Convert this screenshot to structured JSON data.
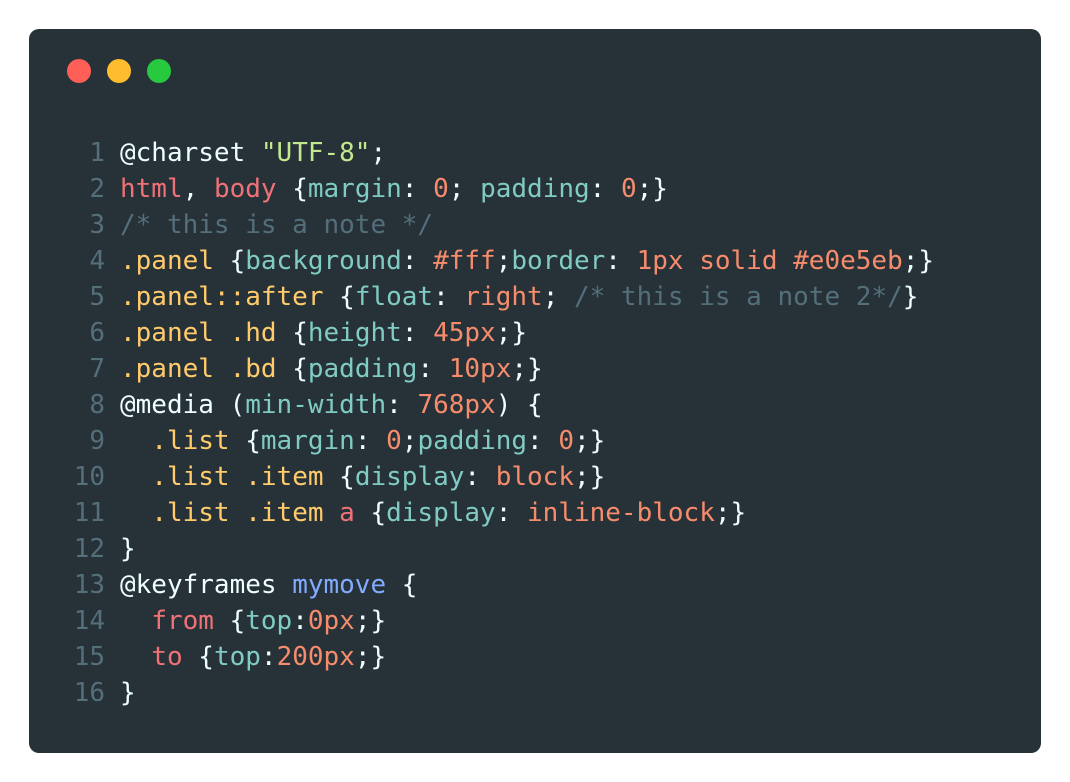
{
  "window": {
    "controls": [
      {
        "name": "close",
        "color": "#ff5f56"
      },
      {
        "name": "minimize",
        "color": "#ffbd2e"
      },
      {
        "name": "maximize",
        "color": "#27c93f"
      }
    ]
  },
  "colors": {
    "background": "#263238",
    "default": "#eeffff",
    "line_number": "#546e7a",
    "tag": "#f07178",
    "property": "#80cbc4",
    "number": "#f78c6c",
    "comment": "#546e7a",
    "selector": "#ffcb6b",
    "string": "#c3e88d",
    "function": "#82aaff",
    "atrule": "#eeffff"
  },
  "code_lines": [
    {
      "n": "1",
      "tokens": [
        {
          "t": "@charset ",
          "k": "atrule"
        },
        {
          "t": "\"UTF-8\"",
          "k": "string"
        },
        {
          "t": ";",
          "k": "default"
        }
      ]
    },
    {
      "n": "2",
      "tokens": [
        {
          "t": "html",
          "k": "tag"
        },
        {
          "t": ", ",
          "k": "default"
        },
        {
          "t": "body",
          "k": "tag"
        },
        {
          "t": " {",
          "k": "default"
        },
        {
          "t": "margin",
          "k": "property"
        },
        {
          "t": ": ",
          "k": "default"
        },
        {
          "t": "0",
          "k": "number"
        },
        {
          "t": "; ",
          "k": "default"
        },
        {
          "t": "padding",
          "k": "property"
        },
        {
          "t": ": ",
          "k": "default"
        },
        {
          "t": "0",
          "k": "number"
        },
        {
          "t": ";}",
          "k": "default"
        }
      ]
    },
    {
      "n": "3",
      "tokens": [
        {
          "t": "/* this is a note */",
          "k": "comment"
        }
      ]
    },
    {
      "n": "4",
      "tokens": [
        {
          "t": ".panel",
          "k": "selector"
        },
        {
          "t": " {",
          "k": "default"
        },
        {
          "t": "background",
          "k": "property"
        },
        {
          "t": ": ",
          "k": "default"
        },
        {
          "t": "#fff",
          "k": "number"
        },
        {
          "t": ";",
          "k": "default"
        },
        {
          "t": "border",
          "k": "property"
        },
        {
          "t": ": ",
          "k": "default"
        },
        {
          "t": "1px solid #e0e5eb",
          "k": "number"
        },
        {
          "t": ";}",
          "k": "default"
        }
      ]
    },
    {
      "n": "5",
      "tokens": [
        {
          "t": ".panel::after",
          "k": "selector"
        },
        {
          "t": " {",
          "k": "default"
        },
        {
          "t": "float",
          "k": "property"
        },
        {
          "t": ": ",
          "k": "default"
        },
        {
          "t": "right",
          "k": "number"
        },
        {
          "t": "; ",
          "k": "default"
        },
        {
          "t": "/* this is a note 2*/",
          "k": "comment"
        },
        {
          "t": "}",
          "k": "default"
        }
      ]
    },
    {
      "n": "6",
      "tokens": [
        {
          "t": ".panel .hd",
          "k": "selector"
        },
        {
          "t": " {",
          "k": "default"
        },
        {
          "t": "height",
          "k": "property"
        },
        {
          "t": ": ",
          "k": "default"
        },
        {
          "t": "45px",
          "k": "number"
        },
        {
          "t": ";}",
          "k": "default"
        }
      ]
    },
    {
      "n": "7",
      "tokens": [
        {
          "t": ".panel .bd",
          "k": "selector"
        },
        {
          "t": " {",
          "k": "default"
        },
        {
          "t": "padding",
          "k": "property"
        },
        {
          "t": ": ",
          "k": "default"
        },
        {
          "t": "10px",
          "k": "number"
        },
        {
          "t": ";}",
          "k": "default"
        }
      ]
    },
    {
      "n": "8",
      "tokens": [
        {
          "t": "@media (",
          "k": "atrule"
        },
        {
          "t": "min-width",
          "k": "property"
        },
        {
          "t": ": ",
          "k": "default"
        },
        {
          "t": "768px",
          "k": "number"
        },
        {
          "t": ") {",
          "k": "default"
        }
      ]
    },
    {
      "n": "9",
      "tokens": [
        {
          "t": "  ",
          "k": "default"
        },
        {
          "t": ".list",
          "k": "selector"
        },
        {
          "t": " {",
          "k": "default"
        },
        {
          "t": "margin",
          "k": "property"
        },
        {
          "t": ": ",
          "k": "default"
        },
        {
          "t": "0",
          "k": "number"
        },
        {
          "t": ";",
          "k": "default"
        },
        {
          "t": "padding",
          "k": "property"
        },
        {
          "t": ": ",
          "k": "default"
        },
        {
          "t": "0",
          "k": "number"
        },
        {
          "t": ";}",
          "k": "default"
        }
      ]
    },
    {
      "n": "10",
      "tokens": [
        {
          "t": "  ",
          "k": "default"
        },
        {
          "t": ".list .item",
          "k": "selector"
        },
        {
          "t": " {",
          "k": "default"
        },
        {
          "t": "display",
          "k": "property"
        },
        {
          "t": ": ",
          "k": "default"
        },
        {
          "t": "block",
          "k": "number"
        },
        {
          "t": ";}",
          "k": "default"
        }
      ]
    },
    {
      "n": "11",
      "tokens": [
        {
          "t": "  ",
          "k": "default"
        },
        {
          "t": ".list .item ",
          "k": "selector"
        },
        {
          "t": "a",
          "k": "tag"
        },
        {
          "t": " {",
          "k": "default"
        },
        {
          "t": "display",
          "k": "property"
        },
        {
          "t": ": ",
          "k": "default"
        },
        {
          "t": "inline-block",
          "k": "number"
        },
        {
          "t": ";}",
          "k": "default"
        }
      ]
    },
    {
      "n": "12",
      "tokens": [
        {
          "t": "}",
          "k": "default"
        }
      ]
    },
    {
      "n": "13",
      "tokens": [
        {
          "t": "@keyframes ",
          "k": "atrule"
        },
        {
          "t": "mymove",
          "k": "function"
        },
        {
          "t": " {",
          "k": "default"
        }
      ]
    },
    {
      "n": "14",
      "tokens": [
        {
          "t": "  ",
          "k": "default"
        },
        {
          "t": "from",
          "k": "tag"
        },
        {
          "t": " {",
          "k": "default"
        },
        {
          "t": "top",
          "k": "property"
        },
        {
          "t": ":",
          "k": "default"
        },
        {
          "t": "0px",
          "k": "number"
        },
        {
          "t": ";}",
          "k": "default"
        }
      ]
    },
    {
      "n": "15",
      "tokens": [
        {
          "t": "  ",
          "k": "default"
        },
        {
          "t": "to",
          "k": "tag"
        },
        {
          "t": " {",
          "k": "default"
        },
        {
          "t": "top",
          "k": "property"
        },
        {
          "t": ":",
          "k": "default"
        },
        {
          "t": "200px",
          "k": "number"
        },
        {
          "t": ";}",
          "k": "default"
        }
      ]
    },
    {
      "n": "16",
      "tokens": [
        {
          "t": "}",
          "k": "default"
        }
      ]
    }
  ]
}
